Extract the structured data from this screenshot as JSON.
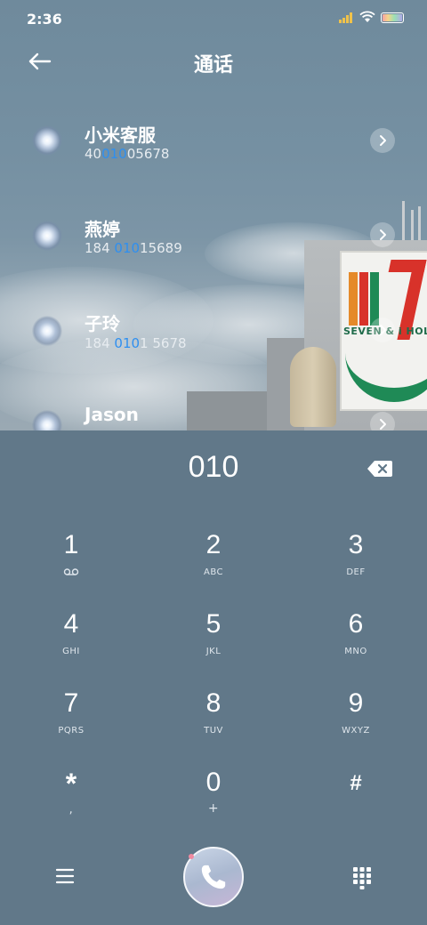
{
  "status_bar": {
    "time": "2:36"
  },
  "header": {
    "title": "通话"
  },
  "contacts": [
    {
      "name": "小米客服",
      "number_parts": [
        "40",
        "010",
        "05678"
      ]
    },
    {
      "name": "燕婷",
      "number_parts": [
        "184 ",
        "010",
        "15689"
      ]
    },
    {
      "name": "子玲",
      "number_parts": [
        "184 ",
        "010",
        "1 5678"
      ]
    },
    {
      "name": "Jason"
    }
  ],
  "wallpaper_sign": {
    "text": "SEVEN & i HOLDINGS"
  },
  "dialer": {
    "input_value": "010",
    "keys": [
      {
        "digit": "1",
        "letters": ""
      },
      {
        "digit": "2",
        "letters": "ABC"
      },
      {
        "digit": "3",
        "letters": "DEF"
      },
      {
        "digit": "4",
        "letters": "GHI"
      },
      {
        "digit": "5",
        "letters": "JKL"
      },
      {
        "digit": "6",
        "letters": "MNO"
      },
      {
        "digit": "7",
        "letters": "PQRS"
      },
      {
        "digit": "8",
        "letters": "TUV"
      },
      {
        "digit": "9",
        "letters": "WXYZ"
      },
      {
        "digit": "*",
        "letters": ","
      },
      {
        "digit": "0",
        "letters": "+"
      },
      {
        "digit": "#",
        "letters": ""
      }
    ]
  },
  "icons": {
    "back": "arrow-left-icon",
    "backspace": "backspace-icon",
    "voicemail": "voicemail-icon",
    "menu": "menu-icon",
    "call": "phone-icon",
    "keypad": "dialpad-icon",
    "chevron": "chevron-right-icon"
  },
  "colors": {
    "highlight": "#2e8ff0",
    "dialer_background": "#617889"
  }
}
